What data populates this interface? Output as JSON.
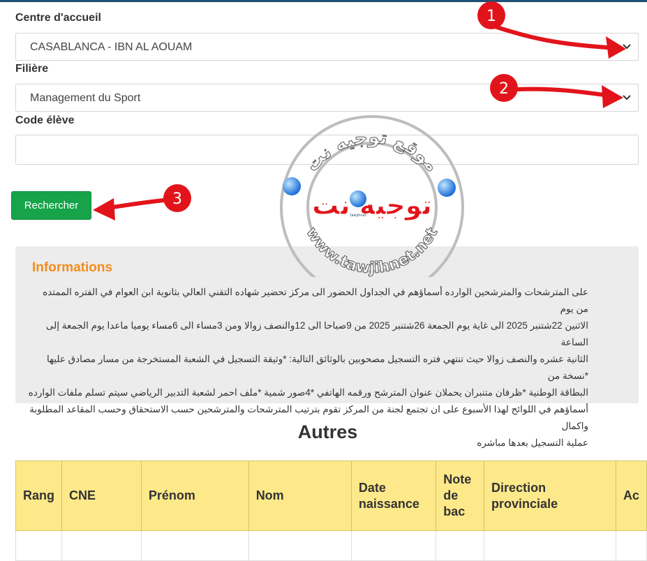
{
  "form": {
    "centre_label": "Centre d'accueil",
    "centre_value": "CASABLANCA - IBN AL AOUAM",
    "filiere_label": "Filière",
    "filiere_value": "Management du Sport",
    "code_label": "Code élève",
    "code_value": "",
    "search_button": "Rechercher"
  },
  "annotations": [
    "1",
    "2",
    "3"
  ],
  "watermark": {
    "main": "توجيه نت",
    "ring_top": "موقع توجيه نت",
    "ring_bottom": "www.tawjihnet.net",
    "badge": "tawjihnet"
  },
  "info": {
    "title": "Informations",
    "lines": [
      "على المترشحات والمترشحين الوارده أسماؤهم في الجداول الحضور الى مركز تحضير شهاده التقني العالي بثانوية ابن العوام في الفتره الممتده من يوم",
      "الاثنين 22شتنبر 2025 الى غاية يوم الجمعة 26شتنبر 2025 من 9صباحا الى 12والنصف زوالا ومن 3مساء الى 6مساء يوميا ماعدا يوم الجمعة إلى الساعة",
      "الثانية عشره والنصف زوالا حيث تنتهي فتره التسجيل مصحوبين بالوثائق التالية: *وثيقة التسجيل في الشعبة المستخرجة من مسار مصادق عليها *نسخة من",
      "البطاقة الوطنية *ظرفان متنبران يحملان عنوان المترشح ورقمه الهاتفي *4صور شمية *ملف احمر لشعبة التدبير الرياضي سيتم تسلم ملفات الوارده",
      "أسماؤهم في اللوائح لهذا الأسبوع على ان تجتمع لجنة من المركز تقوم بترتيب المترشحات والمترشحين حسب الاستحقاق وحسب المقاعد المطلوبة واكمال",
      "عملية التسجيل بعدها مباشره"
    ]
  },
  "section_title": "Autres",
  "table": {
    "headers": [
      "Rang",
      "CNE",
      "Prénom",
      "Nom",
      "Date naissance",
      "Note de bac",
      "Direction provinciale",
      "Ac"
    ]
  },
  "colors": {
    "button": "#16a34a",
    "info_title": "#f28c1e",
    "table_header": "#fde98a",
    "arrow": "#e2141b",
    "watermark_text": "#e2141b"
  }
}
